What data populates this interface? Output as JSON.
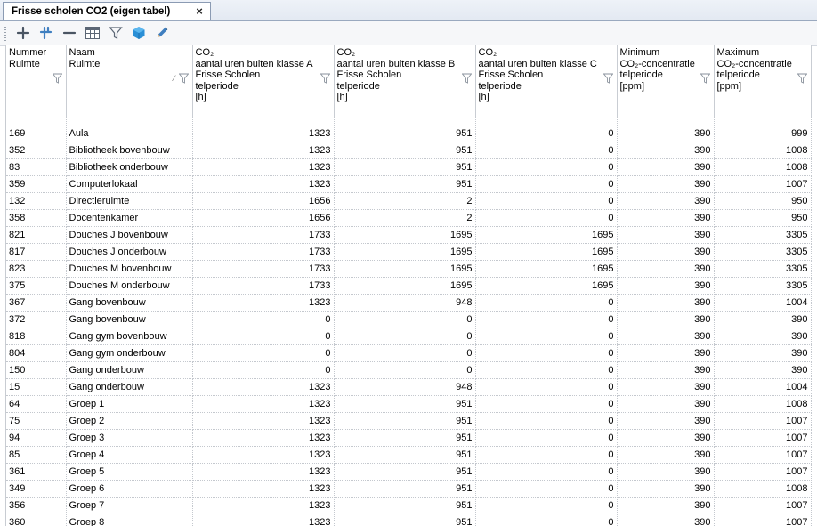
{
  "tab": {
    "title": "Frisse scholen CO2 (eigen tabel)",
    "close": "×"
  },
  "toolbar": {
    "icons": [
      "plus-icon",
      "add-multiple-icon",
      "minus-icon",
      "table-icon",
      "filter-icon",
      "cube-icon",
      "pencil-icon"
    ]
  },
  "columns": [
    {
      "lines": [
        "Nummer",
        "Ruimte"
      ]
    },
    {
      "lines": [
        "Naam",
        "Ruimte"
      ]
    },
    {
      "lines": [
        "CO₂",
        "aantal uren buiten klasse A",
        "Frisse Scholen",
        "telperiode",
        "[h]"
      ]
    },
    {
      "lines": [
        "CO₂",
        "aantal uren buiten klasse B",
        "Frisse Scholen",
        "telperiode",
        "[h]"
      ]
    },
    {
      "lines": [
        "CO₂",
        "aantal uren buiten klasse C",
        "Frisse Scholen",
        "telperiode",
        "[h]"
      ]
    },
    {
      "lines": [
        "Minimum",
        "CO₂-concentratie",
        "telperiode",
        "[ppm]"
      ]
    },
    {
      "lines": [
        "Maximum",
        "CO₂-concentratie",
        "telperiode",
        "[ppm]"
      ]
    }
  ],
  "rows": [
    [
      "169",
      "Aula",
      "1323",
      "951",
      "0",
      "390",
      "999"
    ],
    [
      "352",
      "Bibliotheek bovenbouw",
      "1323",
      "951",
      "0",
      "390",
      "1008"
    ],
    [
      "83",
      "Bibliotheek onderbouw",
      "1323",
      "951",
      "0",
      "390",
      "1008"
    ],
    [
      "359",
      "Computerlokaal",
      "1323",
      "951",
      "0",
      "390",
      "1007"
    ],
    [
      "132",
      "Directieruimte",
      "1656",
      "2",
      "0",
      "390",
      "950"
    ],
    [
      "358",
      "Docentenkamer",
      "1656",
      "2",
      "0",
      "390",
      "950"
    ],
    [
      "821",
      "Douches J bovenbouw",
      "1733",
      "1695",
      "1695",
      "390",
      "3305"
    ],
    [
      "817",
      "Douches J onderbouw",
      "1733",
      "1695",
      "1695",
      "390",
      "3305"
    ],
    [
      "823",
      "Douches M bovenbouw",
      "1733",
      "1695",
      "1695",
      "390",
      "3305"
    ],
    [
      "375",
      "Douches M onderbouw",
      "1733",
      "1695",
      "1695",
      "390",
      "3305"
    ],
    [
      "367",
      "Gang bovenbouw",
      "1323",
      "948",
      "0",
      "390",
      "1004"
    ],
    [
      "372",
      "Gang bovenbouw",
      "0",
      "0",
      "0",
      "390",
      "390"
    ],
    [
      "818",
      "Gang gym bovenbouw",
      "0",
      "0",
      "0",
      "390",
      "390"
    ],
    [
      "804",
      "Gang gym onderbouw",
      "0",
      "0",
      "0",
      "390",
      "390"
    ],
    [
      "150",
      "Gang onderbouw",
      "0",
      "0",
      "0",
      "390",
      "390"
    ],
    [
      "15",
      "Gang onderbouw",
      "1323",
      "948",
      "0",
      "390",
      "1004"
    ],
    [
      "64",
      "Groep 1",
      "1323",
      "951",
      "0",
      "390",
      "1008"
    ],
    [
      "75",
      "Groep 2",
      "1323",
      "951",
      "0",
      "390",
      "1007"
    ],
    [
      "94",
      "Groep 3",
      "1323",
      "951",
      "0",
      "390",
      "1007"
    ],
    [
      "85",
      "Groep 4",
      "1323",
      "951",
      "0",
      "390",
      "1007"
    ],
    [
      "361",
      "Groep 5",
      "1323",
      "951",
      "0",
      "390",
      "1007"
    ],
    [
      "349",
      "Groep 6",
      "1323",
      "951",
      "0",
      "390",
      "1008"
    ],
    [
      "356",
      "Groep 7",
      "1323",
      "951",
      "0",
      "390",
      "1007"
    ],
    [
      "360",
      "Groep 8",
      "1323",
      "951",
      "0",
      "390",
      "1007"
    ]
  ]
}
